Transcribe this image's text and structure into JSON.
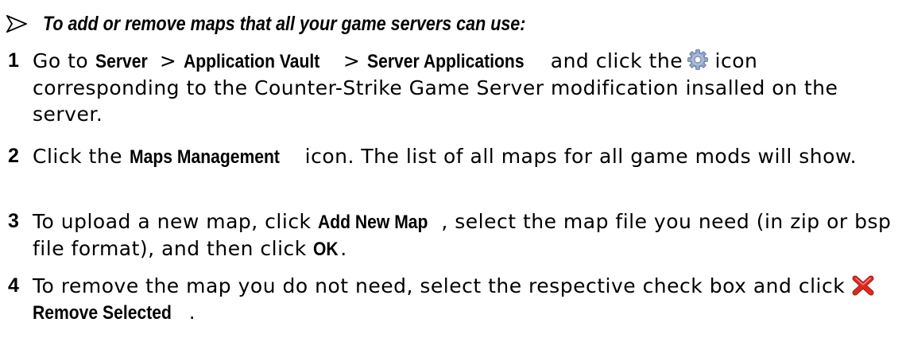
{
  "heading": "To add or remove maps that all your game servers can use:",
  "steps": [
    {
      "number": "1",
      "parts": {
        "t1": "Go to ",
        "b1": "Server",
        "t2": " > ",
        "b2": "Application Vault",
        "t3": " > ",
        "b3": "Server Applications",
        "t4": " and click the",
        "icon": "gear-icon",
        "t5": " icon corresponding to the Counter-Strike Game Server modification insalled on the server."
      }
    },
    {
      "number": "2",
      "parts": {
        "t1": "Click the ",
        "b1": "Maps Management",
        "t2": " icon. The list of all maps for all game mods will show."
      }
    },
    {
      "number": "3",
      "parts": {
        "t1": "To upload a new map, click ",
        "b1": "Add New Map",
        "t2": ", select the map file you need (in zip or bsp file format), and then click ",
        "b2": "OK",
        "t3": "."
      }
    },
    {
      "number": "4",
      "parts": {
        "t1": "To remove the map you do not need, select the respective check box and click ",
        "icon": "red-x-icon",
        "b1": "Remove Selected",
        "t2": "."
      }
    }
  ],
  "colors": {
    "text": "#000000",
    "gear": "#8fa3c8",
    "remove_icon": "#e0281e"
  }
}
